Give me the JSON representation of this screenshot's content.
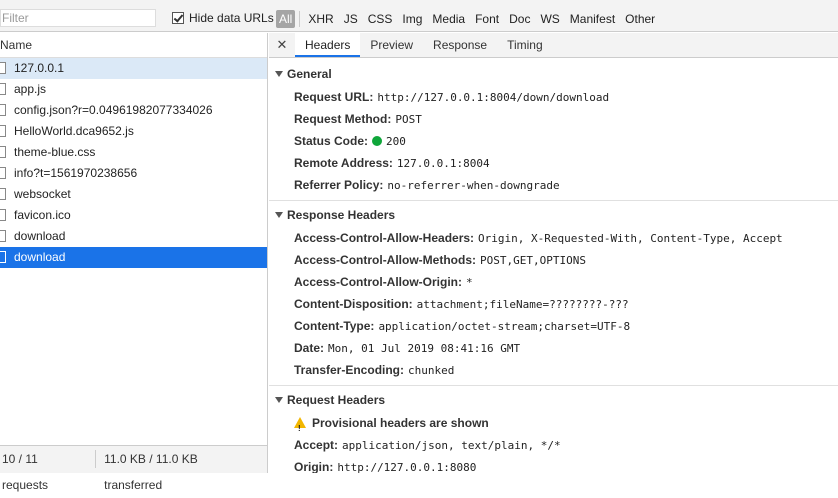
{
  "filter": {
    "placeholder": "Filter"
  },
  "hide_data_urls": {
    "label": "Hide data URLs",
    "checked": true
  },
  "type_filters": [
    "All",
    "XHR",
    "JS",
    "CSS",
    "Img",
    "Media",
    "Font",
    "Doc",
    "WS",
    "Manifest",
    "Other"
  ],
  "list": {
    "header": "Name",
    "requests": [
      "127.0.0.1",
      "app.js",
      "config.json?r=0.04961982077334026",
      "HelloWorld.dca9652.js",
      "theme-blue.css",
      "info?t=1561970238656",
      "websocket",
      "favicon.ico",
      "download",
      "download"
    ]
  },
  "status_bar": {
    "requests": "10 / 11 requests",
    "transfer": "11.0 KB / 11.0 KB transferred"
  },
  "detail": {
    "close": "✕",
    "tabs": [
      "Headers",
      "Preview",
      "Response",
      "Timing"
    ],
    "general": {
      "title": "General",
      "rows": [
        {
          "k": "Request URL:",
          "v": "http://127.0.0.1:8004/down/download"
        },
        {
          "k": "Request Method:",
          "v": "POST"
        },
        {
          "k": "Status Code:",
          "v": "200"
        },
        {
          "k": "Remote Address:",
          "v": "127.0.0.1:8004"
        },
        {
          "k": "Referrer Policy:",
          "v": "no-referrer-when-downgrade"
        }
      ]
    },
    "response_headers": {
      "title": "Response Headers",
      "rows": [
        {
          "k": "Access-Control-Allow-Headers:",
          "v": "Origin, X-Requested-With, Content-Type, Accept"
        },
        {
          "k": "Access-Control-Allow-Methods:",
          "v": "POST,GET,OPTIONS"
        },
        {
          "k": "Access-Control-Allow-Origin:",
          "v": "*"
        },
        {
          "k": "Content-Disposition:",
          "v": "attachment;fileName=????????-???"
        },
        {
          "k": "Content-Type:",
          "v": "application/octet-stream;charset=UTF-8"
        },
        {
          "k": "Date:",
          "v": "Mon, 01 Jul 2019 08:41:16 GMT"
        },
        {
          "k": "Transfer-Encoding:",
          "v": "chunked"
        }
      ]
    },
    "request_headers": {
      "title": "Request Headers",
      "warning": "Provisional headers are shown",
      "rows": [
        {
          "k": "Accept:",
          "v": "application/json, text/plain, */*"
        },
        {
          "k": "Origin:",
          "v": "http://127.0.0.1:8080"
        }
      ]
    }
  },
  "colors": {
    "selected": "#1a73e8",
    "hover": "#dbe9f7",
    "status_ok": "#0fa63a"
  }
}
